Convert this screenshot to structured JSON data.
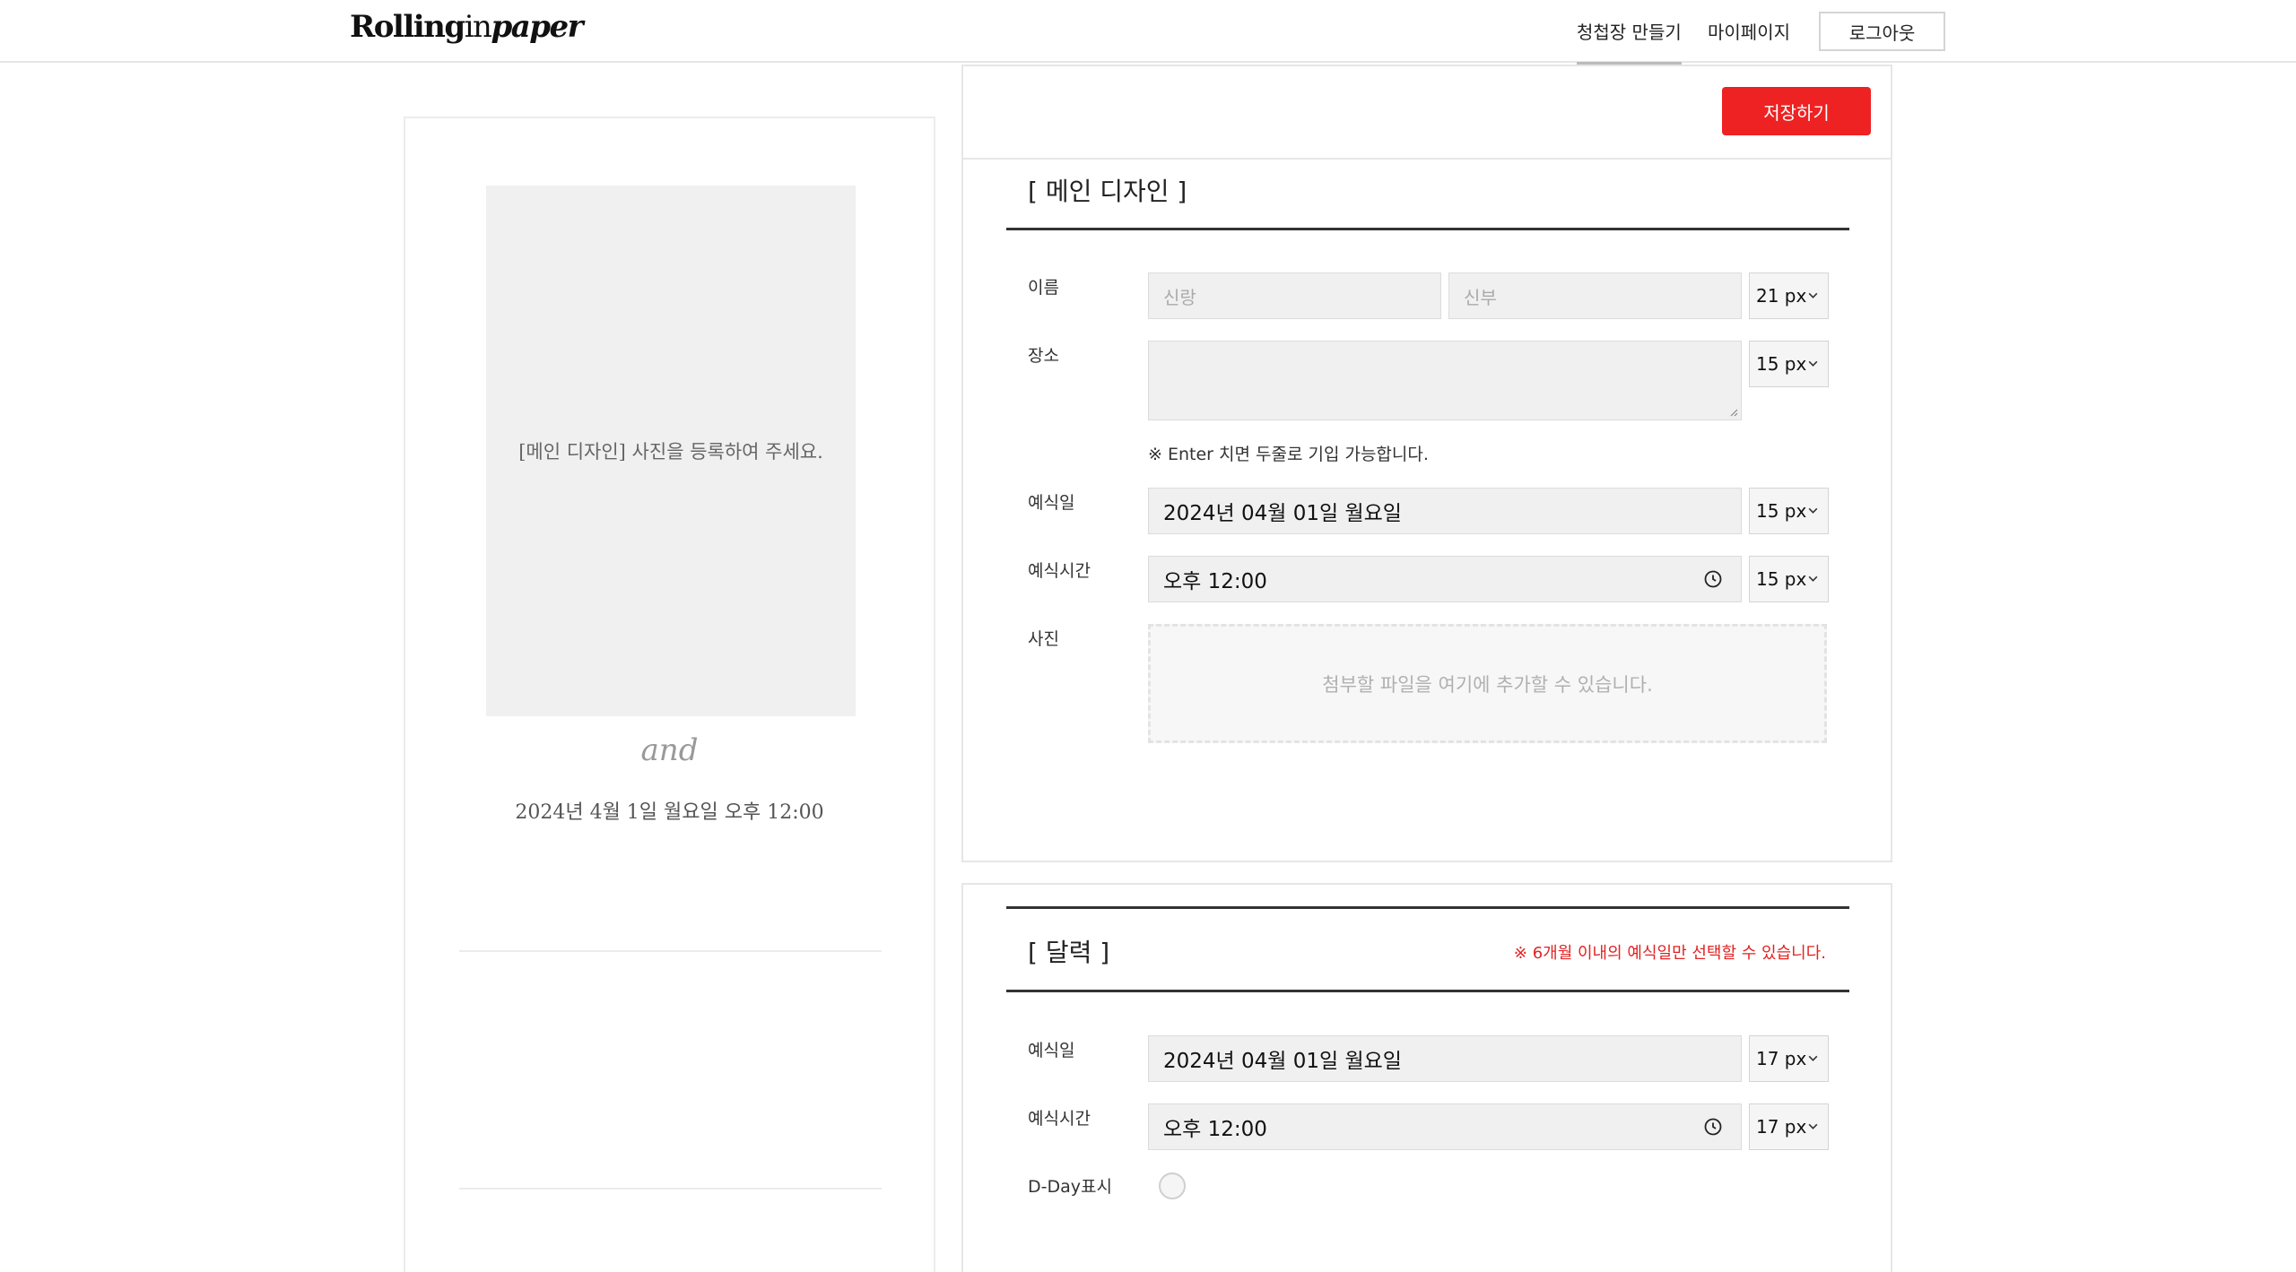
{
  "header": {
    "logo_main": "Rolling",
    "logo_in": "in",
    "logo_paper": "paper",
    "nav": {
      "create": "청첩장 만들기",
      "mypage": "마이페이지",
      "logout": "로그아웃"
    }
  },
  "preview": {
    "photo_placeholder": "[메인 디자인] 사진을 등록하여 주세요.",
    "and": "and",
    "date_text": "2024년 4월 1일 월요일 오후 12:00"
  },
  "editor": {
    "save_label": "저장하기",
    "main_design": {
      "title": "[ 메인 디자인 ]",
      "name_label": "이름",
      "groom_placeholder": "신랑",
      "bride_placeholder": "신부",
      "name_size": "21 px",
      "place_label": "장소",
      "place_size": "15 px",
      "enter_hint": "※ Enter 치면 두줄로 기입 가능합니다.",
      "date_label": "예식일",
      "date_value": "2024년 04월 01일 월요일",
      "date_size": "15 px",
      "time_label": "예식시간",
      "time_value": "오후 12:00",
      "time_size": "15 px",
      "photo_label": "사진",
      "photo_drop_text": "첨부할 파일을 여기에 추가할 수 있습니다."
    },
    "calendar": {
      "title": "[ 달력 ]",
      "notice": "※ 6개월 이내의 예식일만 선택할 수 있습니다.",
      "date_label": "예식일",
      "date_value": "2024년 04월 01일 월요일",
      "date_size": "17 px",
      "time_label": "예식시간",
      "time_value": "오후 12:00",
      "time_size": "17 px",
      "dday_label": "D-Day표시"
    }
  },
  "colors": {
    "accent": "#ee2222",
    "input_bg": "#f0f0f0",
    "border": "#e6e6e6"
  },
  "icons": {
    "clock": "clock-icon",
    "chevron": "chevron-down-icon",
    "resize": "resize-grip-icon"
  }
}
